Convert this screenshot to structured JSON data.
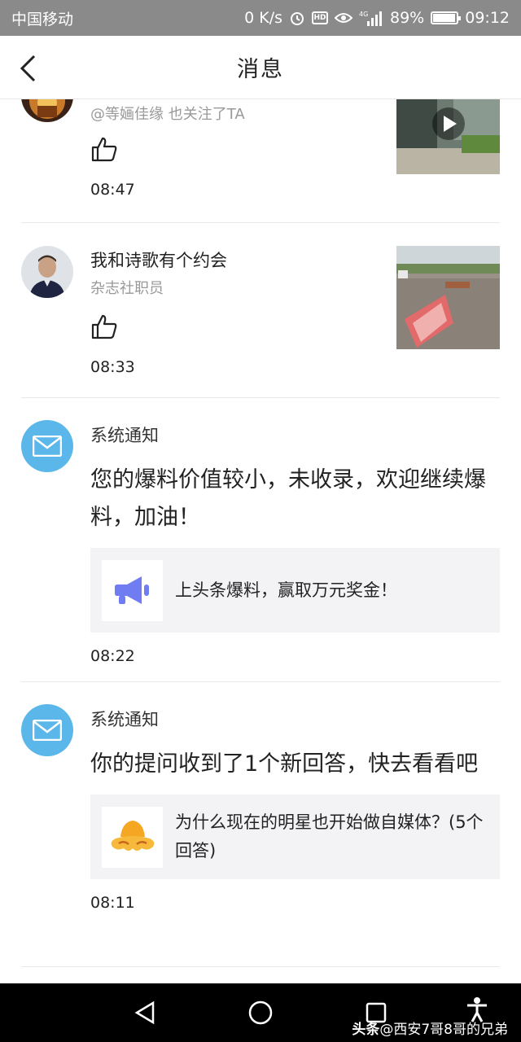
{
  "status_bar": {
    "carrier": "中国移动",
    "speed": "0 K/s",
    "network": "4G",
    "battery": "89%",
    "battery_level": 0.89,
    "time": "09:12"
  },
  "nav": {
    "title": "消息"
  },
  "messages": [
    {
      "type": "follow",
      "name": "",
      "subtitle": "@等婳佳缘 也关注了TA",
      "time": "08:47",
      "has_video": true
    },
    {
      "type": "like",
      "name": "我和诗歌有个约会",
      "subtitle": "杂志社职员",
      "time": "08:33"
    },
    {
      "type": "system",
      "name": "系统通知",
      "message": "您的爆料价值较小，未收录，欢迎继续爆料，加油！",
      "card_text": "上头条爆料，赢取万元奖金！",
      "card_icon": "megaphone-icon",
      "time": "08:22"
    },
    {
      "type": "system",
      "name": "系统通知",
      "message": "你的提问收到了1个新回答，快去看看吧",
      "card_text": "为什么现在的明星也开始做自媒体？(5个回答)",
      "card_icon": "wukong-cloud-icon",
      "time": "08:11"
    }
  ],
  "watermark": {
    "brand": "头条",
    "handle": "@西安7哥8哥的兄弟"
  },
  "colors": {
    "mail_icon_bg": "#5bb7ea",
    "megaphone": "#6f7cf2",
    "status_bar_bg": "#8a8a8a"
  }
}
